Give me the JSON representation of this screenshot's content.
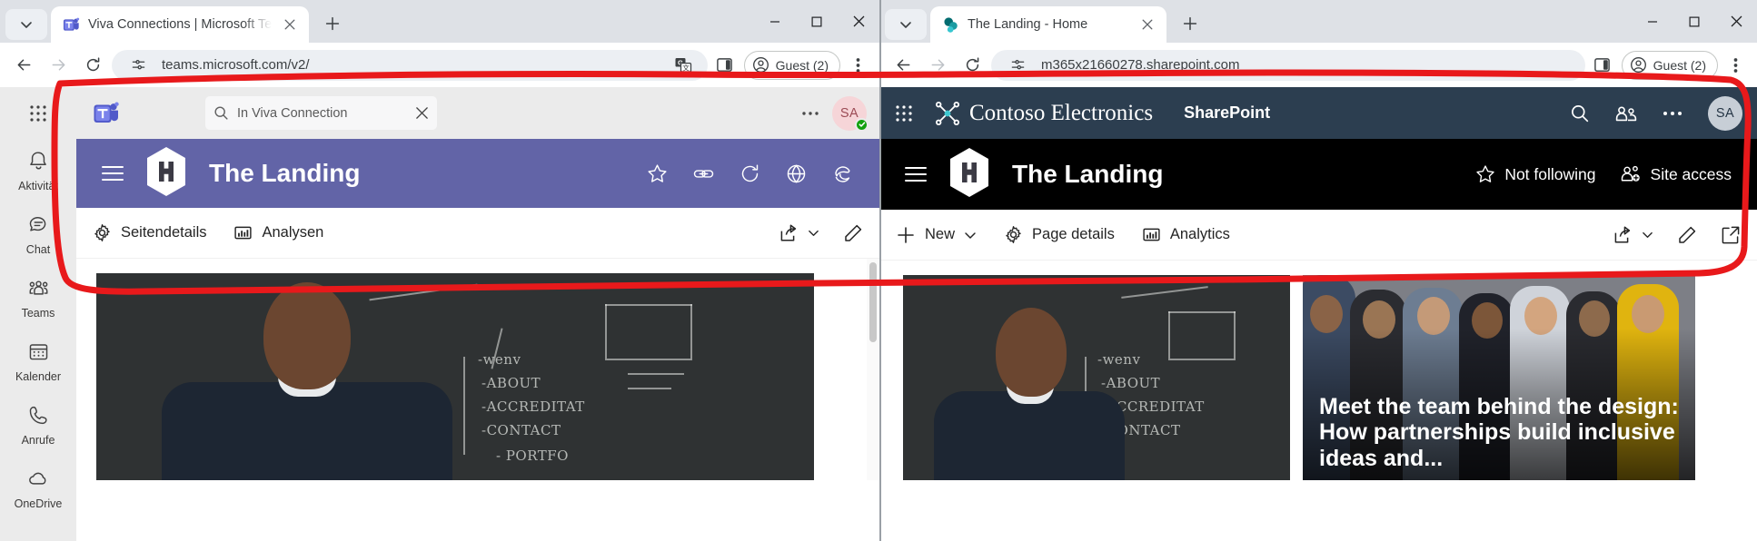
{
  "left_window": {
    "tab": {
      "title": "Viva Connections | Microsoft Te",
      "favicon": "teams-icon",
      "close": "close-icon",
      "newtab": "new-tab-icon",
      "tab_search": "chevron-down-icon"
    },
    "omnibox": {
      "back": "back-arrow-icon",
      "forward": "forward-arrow-icon",
      "reload": "reload-icon",
      "site_info": "site-settings-icon",
      "url": "teams.microsoft.com/v2/",
      "translate": "translate-icon",
      "split_screen": "split-screen-icon",
      "profile_label": "Guest (2)",
      "profile_icon": "account-circle-icon",
      "menu": "kebab-menu-icon"
    },
    "window_controls": {
      "minimize": "minimize-icon",
      "maximize": "maximize-icon",
      "close": "window-close-icon"
    },
    "teams": {
      "waffle": "app-launcher-icon",
      "logo": "microsoft-teams-icon",
      "search": {
        "icon": "search-icon",
        "value": "In Viva Connection",
        "clear": "clear-icon"
      },
      "more": "more-options-icon",
      "avatar": {
        "initials": "SA",
        "presence": "available-status"
      },
      "rail": [
        {
          "label": "Aktivität",
          "icon": "bell-icon"
        },
        {
          "label": "Chat",
          "icon": "chat-icon"
        },
        {
          "label": "Teams",
          "icon": "people-icon"
        },
        {
          "label": "Kalender",
          "icon": "calendar-icon"
        },
        {
          "label": "Anrufe",
          "icon": "phone-icon"
        },
        {
          "label": "OneDrive",
          "icon": "cloud-icon"
        }
      ]
    },
    "site": {
      "hamburger": "hamburger-menu-icon",
      "logo": "hexagon-h-logo",
      "title": "The Landing",
      "header_color": "#6264a7",
      "actions": [
        {
          "icon": "star-icon",
          "label": ""
        },
        {
          "icon": "link-icon",
          "label": ""
        },
        {
          "icon": "refresh-icon",
          "label": ""
        },
        {
          "icon": "globe-icon",
          "label": ""
        },
        {
          "icon": "edge-browser-icon",
          "label": ""
        }
      ]
    },
    "commandbar": {
      "items": [
        {
          "icon": "gear-icon",
          "label": "Seitendetails"
        },
        {
          "icon": "analytics-icon",
          "label": "Analysen"
        }
      ],
      "right": [
        {
          "icon": "share-icon",
          "label": "",
          "chevron": "chevron-down-icon"
        },
        {
          "icon": "pencil-icon",
          "label": ""
        }
      ]
    },
    "hero": {
      "caption": ""
    }
  },
  "right_window": {
    "tab": {
      "title": "The Landing - Home",
      "favicon": "sharepoint-icon",
      "close": "close-icon",
      "newtab": "new-tab-icon",
      "tab_search": "chevron-down-icon"
    },
    "omnibox": {
      "back": "back-arrow-icon",
      "forward": "forward-arrow-icon",
      "reload": "reload-icon",
      "site_info": "site-settings-icon",
      "url": "m365x21660278.sharepoint.com",
      "split_screen": "split-screen-icon",
      "profile_label": "Guest (2)",
      "profile_icon": "account-circle-icon",
      "menu": "kebab-menu-icon"
    },
    "window_controls": {
      "minimize": "minimize-icon",
      "maximize": "maximize-icon",
      "close": "window-close-icon"
    },
    "suite": {
      "waffle": "app-launcher-icon",
      "brand_logo": "contoso-electronics-logo",
      "brand": "Contoso Electronics",
      "product": "SharePoint",
      "search": "search-icon",
      "apps": "meetings-icon",
      "more": "more-options-icon",
      "avatar": {
        "initials": "SA"
      }
    },
    "site": {
      "hamburger": "hamburger-menu-icon",
      "logo": "hexagon-h-logo",
      "title": "The Landing",
      "header_color": "#000000",
      "actions": [
        {
          "icon": "star-icon",
          "label": "Not following"
        },
        {
          "icon": "site-access-icon",
          "label": "Site access"
        }
      ]
    },
    "commandbar": {
      "items": [
        {
          "icon": "plus-icon",
          "label": "New",
          "chevron": "chevron-down-icon"
        },
        {
          "icon": "gear-icon",
          "label": "Page details"
        },
        {
          "icon": "analytics-icon",
          "label": "Analytics"
        }
      ],
      "right": [
        {
          "icon": "share-icon",
          "label": "",
          "chevron": "chevron-down-icon"
        },
        {
          "icon": "pencil-icon",
          "label": ""
        },
        {
          "icon": "expand-icon",
          "label": ""
        }
      ]
    },
    "hero": {
      "tile_left_caption": "",
      "tile_right_caption": "Meet the team behind the design: How partnerships build inclusive ideas and..."
    }
  },
  "annotation": {
    "color": "#e8191b",
    "shape": "hand-drawn-rounded-rectangle-highlight"
  }
}
